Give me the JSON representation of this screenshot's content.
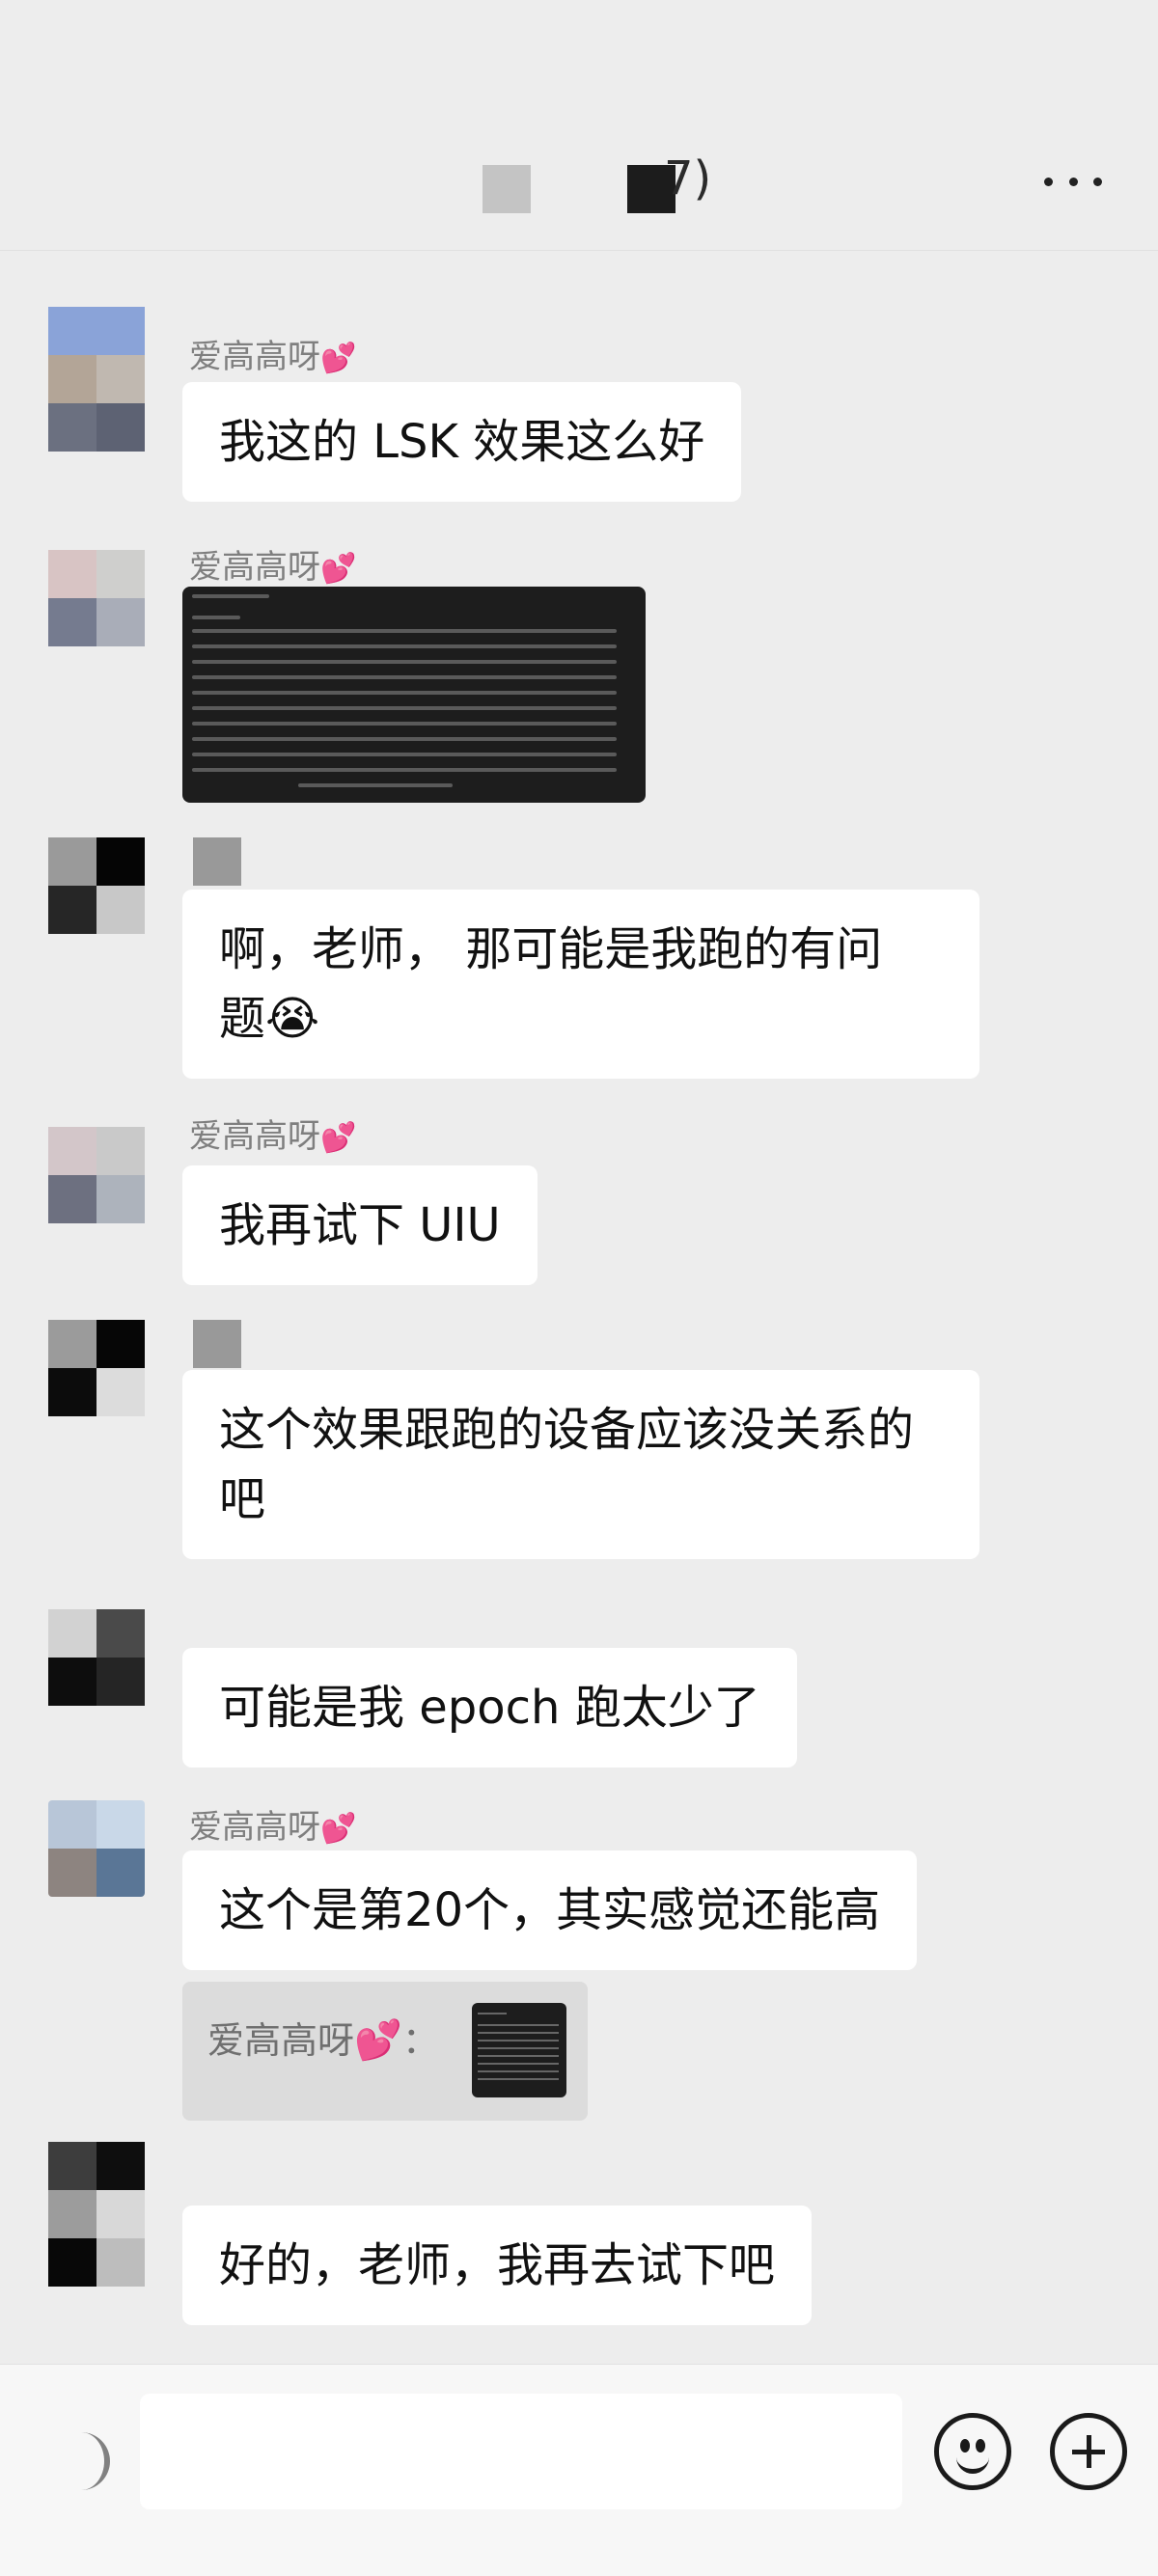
{
  "header": {
    "title_suffix": "7)",
    "more_icon": "more-dots-icon"
  },
  "colors": {
    "background": "#ededed",
    "bubble": "#ffffff",
    "sender_name": "#7f7f7f",
    "heart": "#ff4fa0"
  },
  "messages": [
    {
      "sender": "爱高高呀",
      "sender_heart": "💕",
      "text": "我这的 LSK 效果这么好"
    },
    {
      "sender": "爱高高呀",
      "sender_heart": "💕",
      "type": "image"
    },
    {
      "text_line1": "啊，老师， 那可能是我跑的有问",
      "text_line2": "题",
      "emoji": "😭"
    },
    {
      "sender": "爱高高呀",
      "sender_heart": "💕",
      "text": "我再试下 UIU"
    },
    {
      "text_line1": "这个效果跟跑的设备应该没关系的",
      "text_line2": "吧"
    },
    {
      "text": "可能是我 epoch 跑太少了"
    },
    {
      "sender": "爱高高呀",
      "sender_heart": "💕",
      "text": "这个是第20个，其实感觉还能高",
      "quote": {
        "sender": "爱高高呀",
        "sender_heart": "💕",
        "suffix": "："
      }
    },
    {
      "text": "好的，老师，我再去试下吧"
    }
  ],
  "input_bar": {
    "voice_icon": "voice-icon",
    "emoji_icon": "emoji-icon",
    "plus_icon": "plus-icon"
  }
}
